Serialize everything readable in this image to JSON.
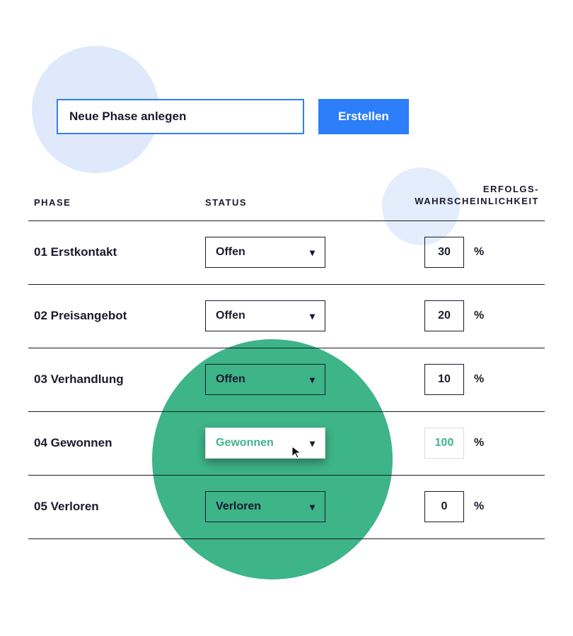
{
  "topbar": {
    "input_value": "Neue Phase anlegen",
    "create_label": "Erstellen"
  },
  "headers": {
    "phase": "PHASE",
    "status": "STATUS",
    "probability": "ERFOLGS-\nWAHRSCHEINLICHKEIT"
  },
  "percent_symbol": "%",
  "rows": [
    {
      "phase": "01 Erstkontakt",
      "status": "Offen",
      "probability": "30",
      "highlight": false
    },
    {
      "phase": "02 Preisangebot",
      "status": "Offen",
      "probability": "20",
      "highlight": false
    },
    {
      "phase": "03 Verhandlung",
      "status": "Offen",
      "probability": "10",
      "highlight": false
    },
    {
      "phase": "04 Gewonnen",
      "status": "Gewonnen",
      "probability": "100",
      "highlight": true
    },
    {
      "phase": "05 Verloren",
      "status": "Verloren",
      "probability": "0",
      "highlight": false
    }
  ],
  "colors": {
    "accent_blue": "#2d7ff9",
    "accent_green": "#3eb489",
    "light_blue": "#e3edfb"
  }
}
